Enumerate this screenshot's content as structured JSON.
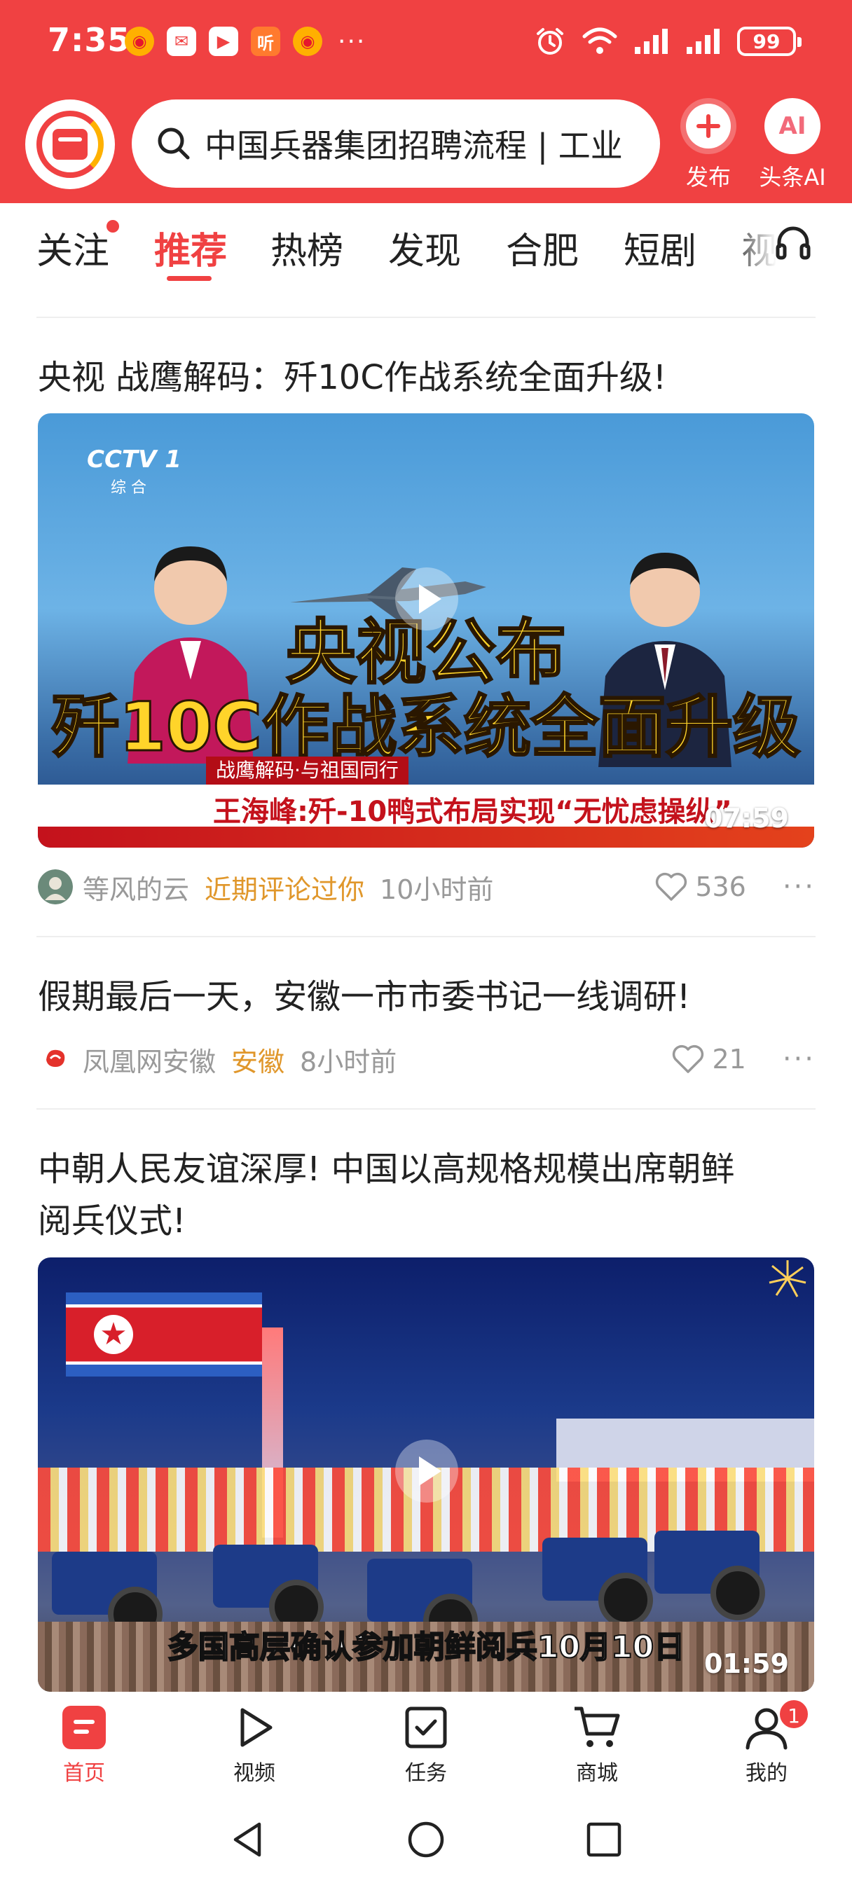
{
  "status_bar": {
    "time": "7:35",
    "notifications": [
      "weibo-icon",
      "mail-icon",
      "video-app-icon",
      "listen-app-icon",
      "weibo-icon"
    ],
    "listen_label": "听",
    "more": "···",
    "battery": "99"
  },
  "header": {
    "search_text": "中国兵器集团招聘流程 | 工业",
    "publish_label": "发布",
    "ai_label": "头条AI",
    "ai_icon_text": "AI",
    "brand_color": "#f04142"
  },
  "tabs": [
    {
      "label": "关注",
      "active": false,
      "dot": true
    },
    {
      "label": "推荐",
      "active": true
    },
    {
      "label": "热榜",
      "active": false
    },
    {
      "label": "发现",
      "active": false
    },
    {
      "label": "合肥",
      "active": false
    },
    {
      "label": "短剧",
      "active": false
    },
    {
      "label": "视",
      "active": false
    }
  ],
  "articles": [
    {
      "title": "央视 战鹰解码：歼10C作战系统全面升级!",
      "video": {
        "channel": "CCTV 1",
        "channel_sub": "综 合",
        "caption_line1": "央视公布",
        "caption_line2": "歼10C作战系统全面升级",
        "ticker_tag": "战鹰解码·与祖国同行",
        "ticker_text": "王海峰:歼-10鸭式布局实现“无忧虑操纵”",
        "duration": "07:59"
      },
      "author": "等风的云",
      "tag": "近期评论过你",
      "time": "10小时前",
      "likes": "536"
    },
    {
      "title": "假期最后一天，安徽一市市委书记一线调研!",
      "author": "凤凰网安徽",
      "tag": "安徽",
      "time": "8小时前",
      "likes": "21"
    },
    {
      "title_line1": "中朝人民友谊深厚! 中国以高规格规模出席朝鲜",
      "title_line2": "阅兵仪式!",
      "video": {
        "caption": "多国高层确认参加朝鲜阅兵10月10日",
        "duration": "01:59"
      }
    }
  ],
  "bottom_nav": [
    {
      "label": "首页",
      "icon": "home-icon",
      "active": true
    },
    {
      "label": "视频",
      "icon": "play-icon",
      "active": false
    },
    {
      "label": "任务",
      "icon": "task-icon",
      "active": false
    },
    {
      "label": "商城",
      "icon": "cart-icon",
      "active": false
    },
    {
      "label": "我的",
      "icon": "profile-icon",
      "active": false,
      "badge": "1"
    }
  ]
}
